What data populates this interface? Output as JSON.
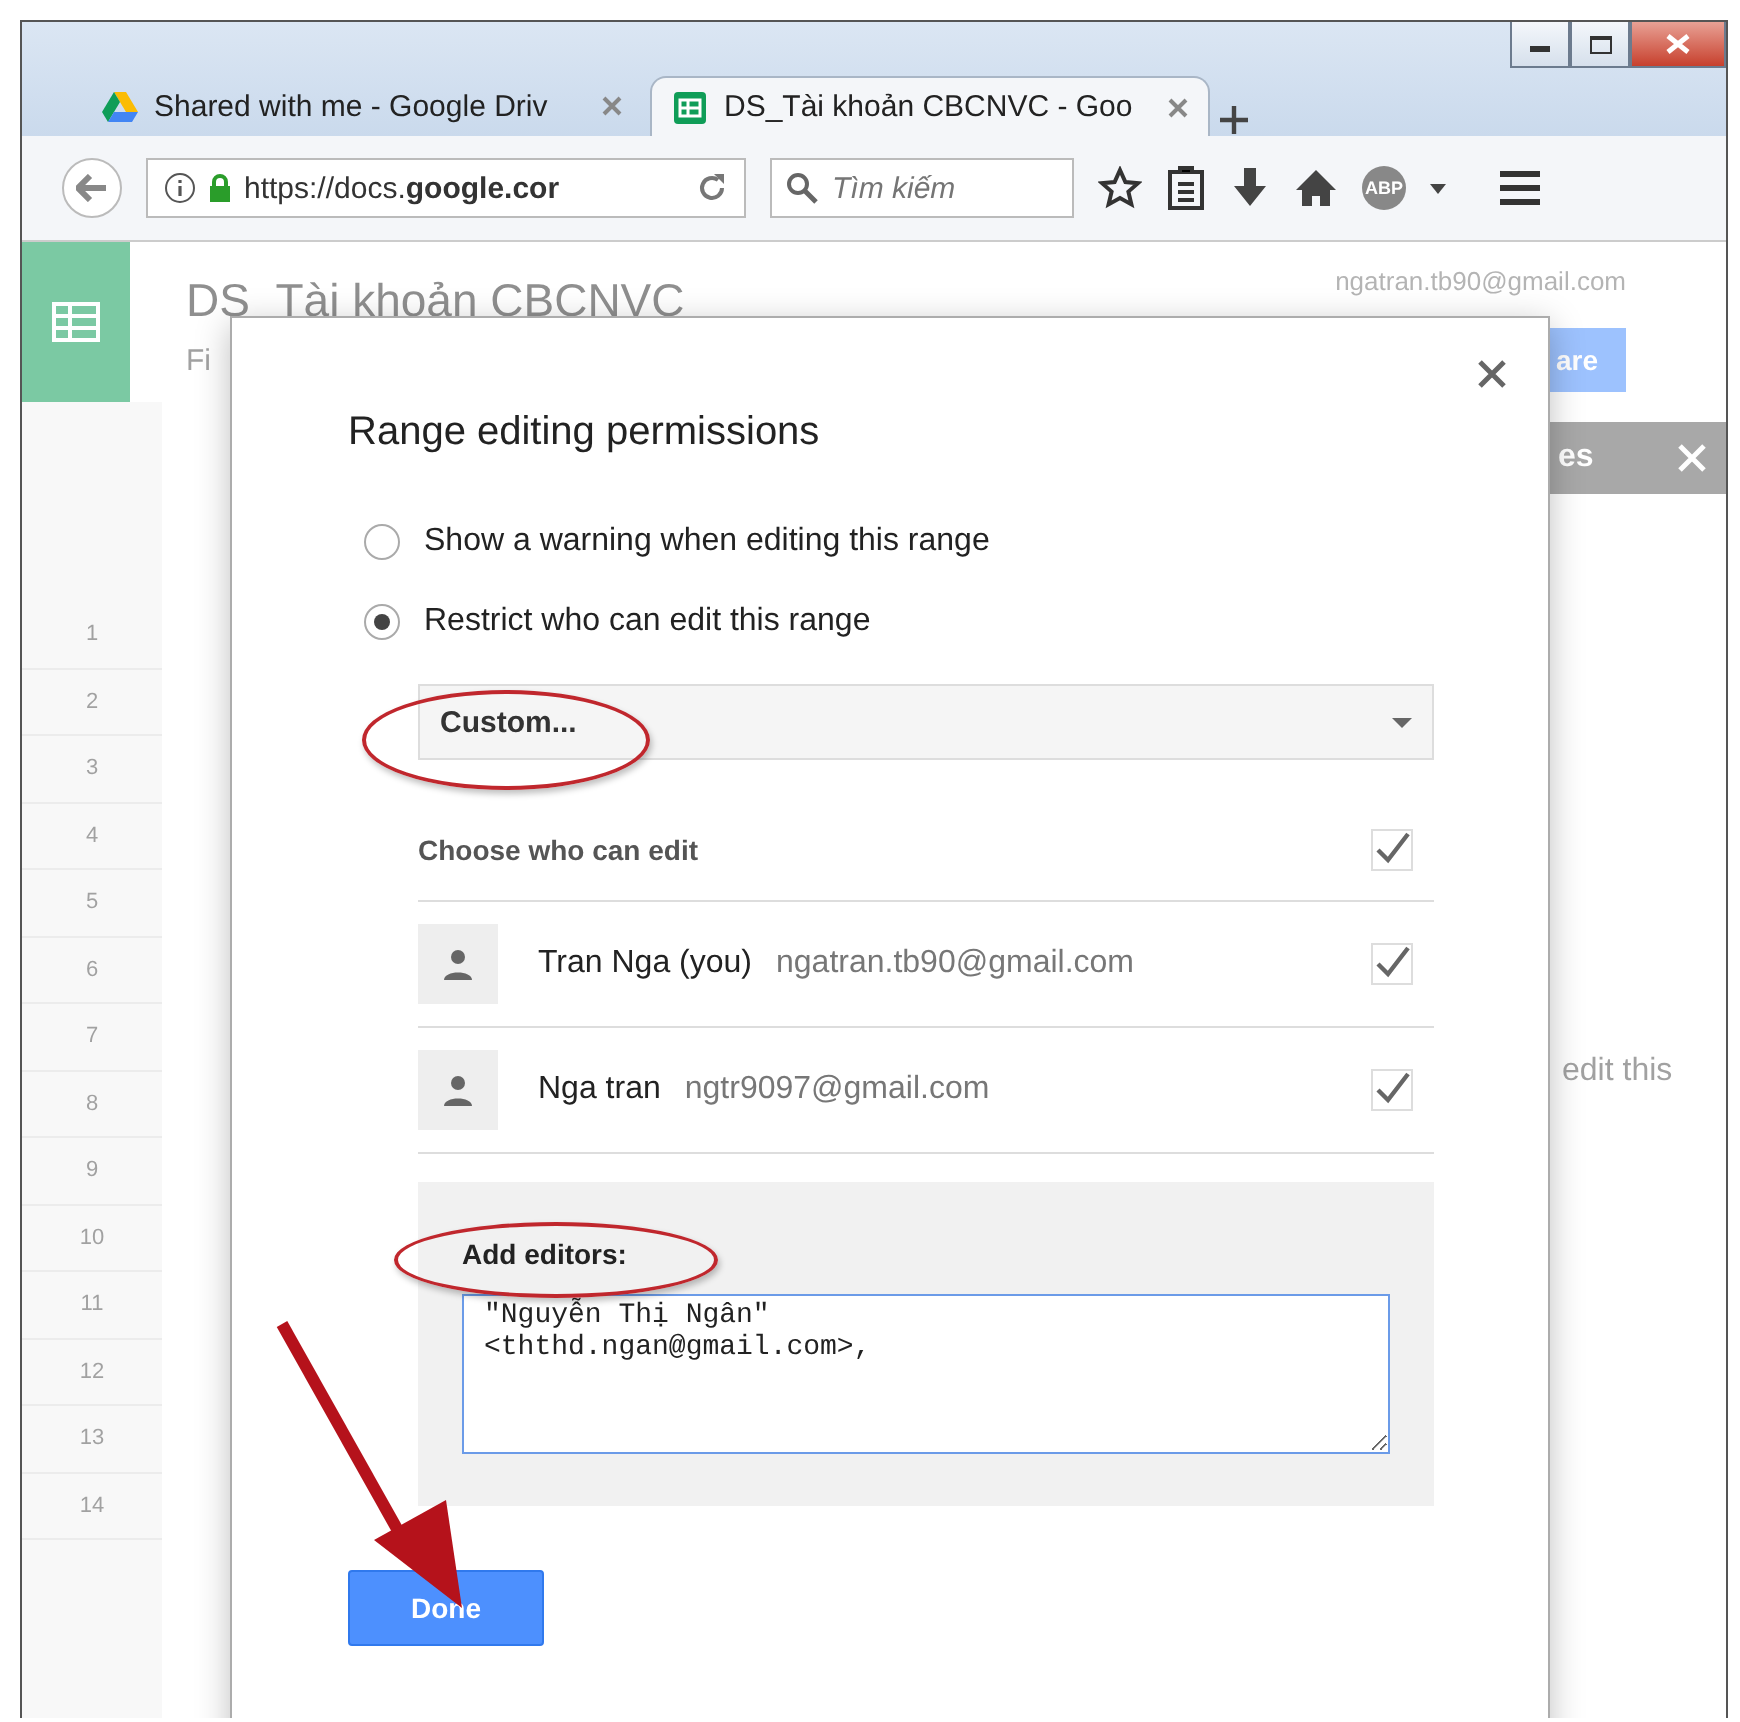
{
  "tabs": [
    {
      "title": "Shared with me - Google Driv",
      "selected": false
    },
    {
      "title": "DS_Tài khoản CBCNVC - Goo",
      "selected": true
    }
  ],
  "address_bar": {
    "url": "https://docs.**google.cor**"
  },
  "search": {
    "placeholder": "Tìm kiếm"
  },
  "adblock_badge": "ABP",
  "document": {
    "title": "DS_Tài khoản CBCNVC",
    "account": "ngatran.tb90@gmail.com",
    "menu_fragment": "Fi",
    "share_fragment": "are",
    "panel_title_fragment": "es",
    "panel_text_fragment": "edit this",
    "row_numbers": [
      "1",
      "2",
      "3",
      "4",
      "5",
      "6",
      "7",
      "8",
      "9",
      "10",
      "11",
      "12",
      "13",
      "14"
    ]
  },
  "dialog": {
    "title": "Range editing permissions",
    "options": [
      {
        "label": "Show a warning when editing this range",
        "selected": false
      },
      {
        "label": "Restrict who can edit this range",
        "selected": true
      }
    ],
    "dropdown": {
      "value": "Custom..."
    },
    "editors": {
      "header": "Choose who can edit",
      "all_checked": true,
      "people": [
        {
          "name": "Tran Nga (you)",
          "email": "ngatran.tb90@gmail.com",
          "checked": true
        },
        {
          "name": "Nga tran",
          "email": "ngtr9097@gmail.com",
          "checked": true
        }
      ]
    },
    "add_editors": {
      "label": "Add editors:",
      "value": "\"Nguyễn Thị Ngân\"\n<ththd.ngan@gmail.com>, "
    },
    "done_label": "Done"
  }
}
